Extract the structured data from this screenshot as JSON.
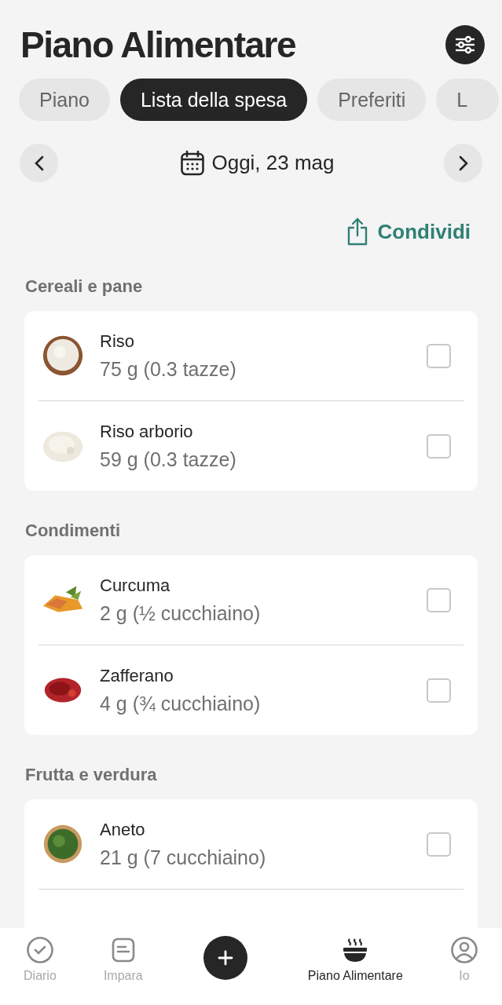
{
  "title": "Piano Alimentare",
  "tabs": [
    {
      "label": "Piano",
      "selected": false
    },
    {
      "label": "Lista della spesa",
      "selected": true
    },
    {
      "label": "Preferiti",
      "selected": false
    },
    {
      "label": "L",
      "selected": false
    }
  ],
  "date": "Oggi, 23 mag",
  "share": "Condividi",
  "sections": [
    {
      "title": "Cereali e pane",
      "items": [
        {
          "name": "Riso",
          "amount": "75 g (0.3 tazze)",
          "checked": false
        },
        {
          "name": "Riso arborio",
          "amount": "59 g (0.3 tazze)",
          "checked": false
        }
      ]
    },
    {
      "title": "Condimenti",
      "items": [
        {
          "name": "Curcuma",
          "amount": "2 g (½ cucchiaino)",
          "checked": false
        },
        {
          "name": "Zafferano",
          "amount": "4 g (¾ cucchiaino)",
          "checked": false
        }
      ]
    },
    {
      "title": "Frutta e verdura",
      "items": [
        {
          "name": "Aneto",
          "amount": "21 g (7 cucchiaino)",
          "checked": false
        }
      ]
    }
  ],
  "nav": [
    {
      "label": "Diario",
      "selected": false
    },
    {
      "label": "Impara",
      "selected": false
    },
    {
      "label": "Piano Alimentare",
      "selected": true
    },
    {
      "label": "Io",
      "selected": false
    }
  ]
}
